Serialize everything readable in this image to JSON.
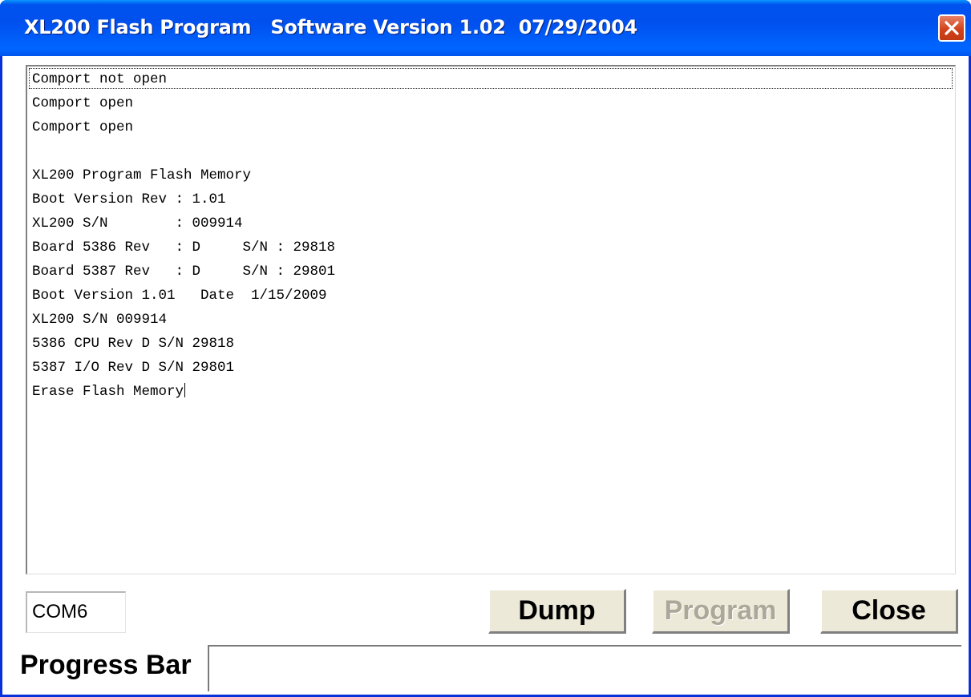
{
  "window": {
    "title": "XL200 Flash Program   Software Version 1.02  07/29/2004",
    "close_icon": "close-x-icon"
  },
  "log": {
    "lines": [
      "Comport not open",
      "Comport open",
      "Comport open",
      "",
      "XL200 Program Flash Memory",
      "Boot Version Rev : 1.01",
      "XL200 S/N        : 009914",
      "Board 5386 Rev   : D     S/N : 29818",
      "Board 5387 Rev   : D     S/N : 29801",
      "Boot Version 1.01   Date  1/15/2009",
      "XL200 S/N 009914",
      "5386 CPU Rev D S/N 29818",
      "5387 I/O Rev D S/N 29801",
      "Erase Flash Memory"
    ]
  },
  "com_port": {
    "value": "COM6"
  },
  "buttons": {
    "dump": "Dump",
    "program": "Program",
    "close": "Close",
    "program_enabled": false
  },
  "progress": {
    "label": "Progress Bar",
    "value_percent": 0
  },
  "colors": {
    "title_bar": "#0053ee",
    "close_button": "#d2421c",
    "window_border": "#0831d9"
  }
}
